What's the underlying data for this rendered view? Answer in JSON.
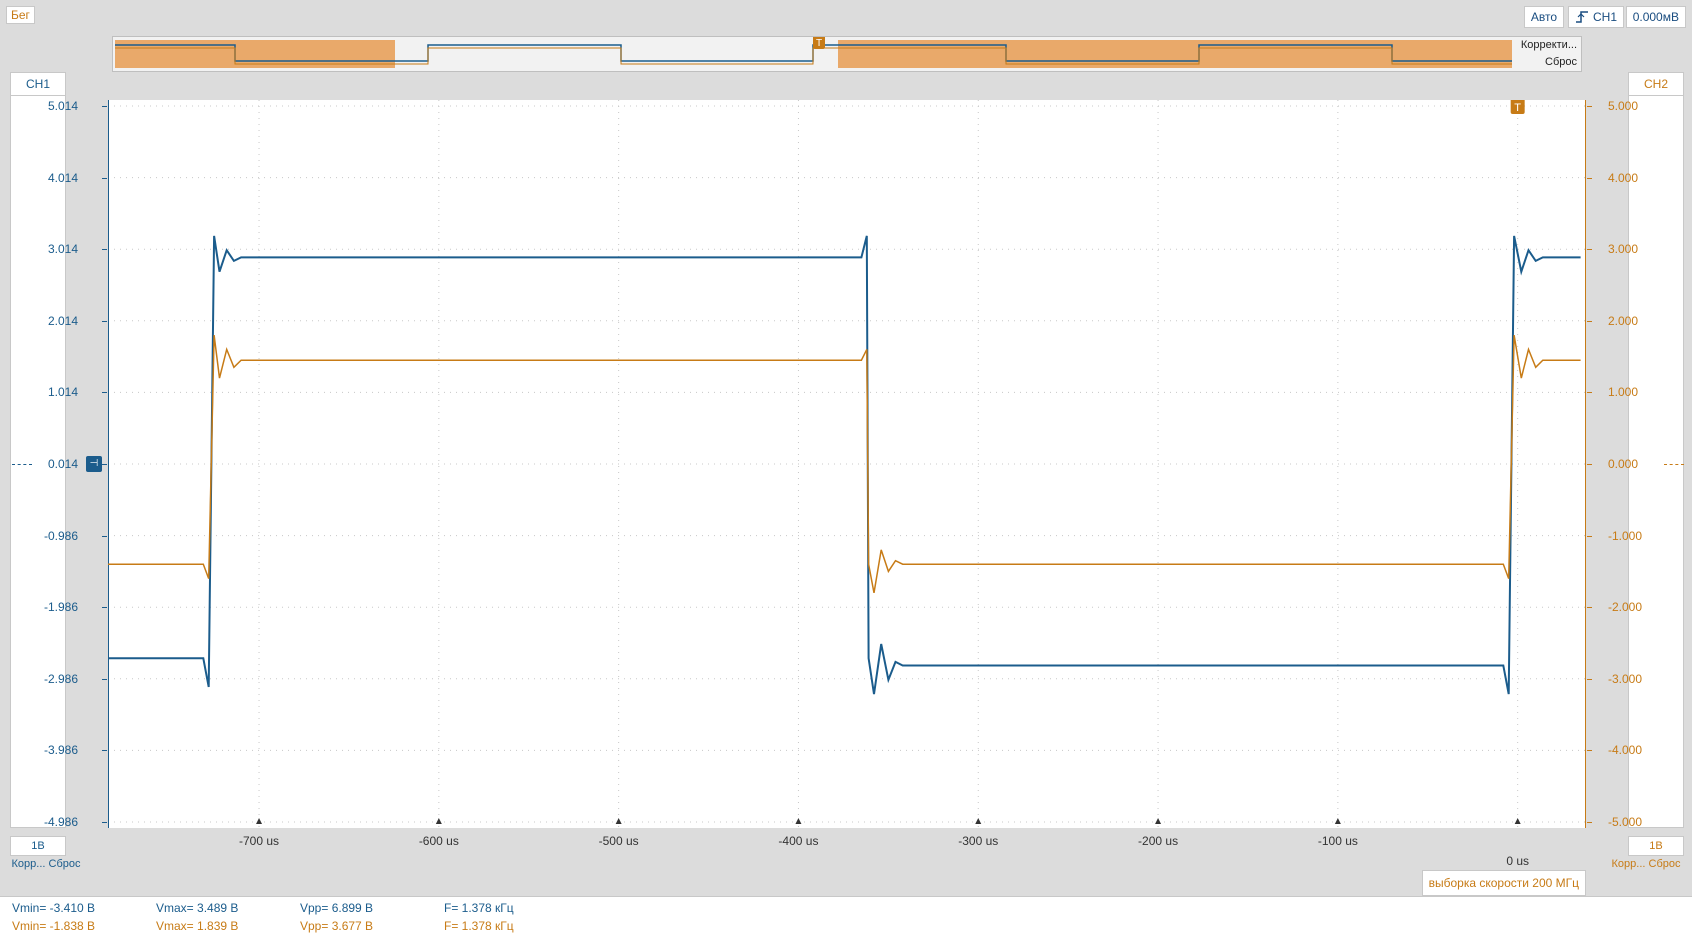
{
  "status": "Бег",
  "toolbar": {
    "mode": "Авто",
    "trigger_channel": "CH1",
    "trigger_level": "0.000мВ"
  },
  "overview": {
    "correction_label": "Корректи...",
    "reset_label": "Сброс",
    "trigger_marker": "T"
  },
  "ch1": {
    "name": "CH1",
    "ticks": [
      "5.014",
      "4.014",
      "3.014",
      "2.014",
      "1.014",
      "0.014",
      "-0.986",
      "-1.986",
      "-2.986",
      "-3.986",
      "-4.986"
    ],
    "scale": "1В",
    "footer": "Корр... Сброс",
    "color": "#1b5c8c"
  },
  "ch2": {
    "name": "CH2",
    "ticks": [
      "5.000",
      "4.000",
      "3.000",
      "2.000",
      "1.000",
      "0.000",
      "-1.000",
      "-2.000",
      "-3.000",
      "-4.000",
      "-5.000"
    ],
    "scale": "1В",
    "footer": "Корр... Сброс",
    "color": "#c77b16"
  },
  "time_axis": {
    "labels": [
      "-700 us",
      "-600 us",
      "-500 us",
      "-400 us",
      "-300 us",
      "-200 us",
      "-100 us",
      "0 us"
    ],
    "trigger_marker": "T"
  },
  "sample_rate": "выборка скорости 200 МГц",
  "measurements": {
    "ch1": {
      "vmin": "Vmin= -3.410 В",
      "vmax": "Vmax= 3.489 В",
      "vpp": "Vpp= 6.899 В",
      "freq": "F= 1.378 кГц"
    },
    "ch2": {
      "vmin": "Vmin= -1.838 В",
      "vmax": "Vmax= 1.839 В",
      "vpp": "Vpp= 3.677 В",
      "freq": "F= 1.378 кГц"
    }
  },
  "chart_data": {
    "type": "line",
    "xlabel": "",
    "ylabel": "",
    "x_unit": "us",
    "xlim": [
      -784,
      38
    ],
    "grid": true,
    "series": [
      {
        "name": "CH1",
        "color": "#1b5c8c",
        "ylim": [
          -4.986,
          5.014
        ],
        "points": [
          [
            -784,
            -2.7
          ],
          [
            -731,
            -2.7
          ],
          [
            -728,
            -3.1
          ],
          [
            -725,
            3.2
          ],
          [
            -722,
            2.7
          ],
          [
            -718,
            3.0
          ],
          [
            -714,
            2.85
          ],
          [
            -710,
            2.9
          ],
          [
            -365,
            2.9
          ],
          [
            -362,
            3.2
          ],
          [
            -361,
            -2.7
          ],
          [
            -358,
            -3.2
          ],
          [
            -354,
            -2.5
          ],
          [
            -350,
            -3.0
          ],
          [
            -346,
            -2.75
          ],
          [
            -342,
            -2.8
          ],
          [
            -8,
            -2.8
          ],
          [
            -5,
            -3.2
          ],
          [
            -2,
            3.2
          ],
          [
            2,
            2.7
          ],
          [
            6,
            3.0
          ],
          [
            10,
            2.85
          ],
          [
            14,
            2.9
          ],
          [
            35,
            2.9
          ]
        ]
      },
      {
        "name": "CH2",
        "color": "#c77b16",
        "ylim": [
          -5.0,
          5.0
        ],
        "points": [
          [
            -784,
            -1.4
          ],
          [
            -731,
            -1.4
          ],
          [
            -728,
            -1.6
          ],
          [
            -725,
            1.8
          ],
          [
            -722,
            1.2
          ],
          [
            -718,
            1.6
          ],
          [
            -714,
            1.35
          ],
          [
            -710,
            1.45
          ],
          [
            -365,
            1.45
          ],
          [
            -362,
            1.6
          ],
          [
            -361,
            -1.4
          ],
          [
            -358,
            -1.8
          ],
          [
            -354,
            -1.2
          ],
          [
            -350,
            -1.5
          ],
          [
            -346,
            -1.35
          ],
          [
            -342,
            -1.4
          ],
          [
            -8,
            -1.4
          ],
          [
            -5,
            -1.6
          ],
          [
            -2,
            1.8
          ],
          [
            2,
            1.2
          ],
          [
            6,
            1.6
          ],
          [
            10,
            1.35
          ],
          [
            14,
            1.45
          ],
          [
            35,
            1.45
          ]
        ]
      }
    ]
  }
}
